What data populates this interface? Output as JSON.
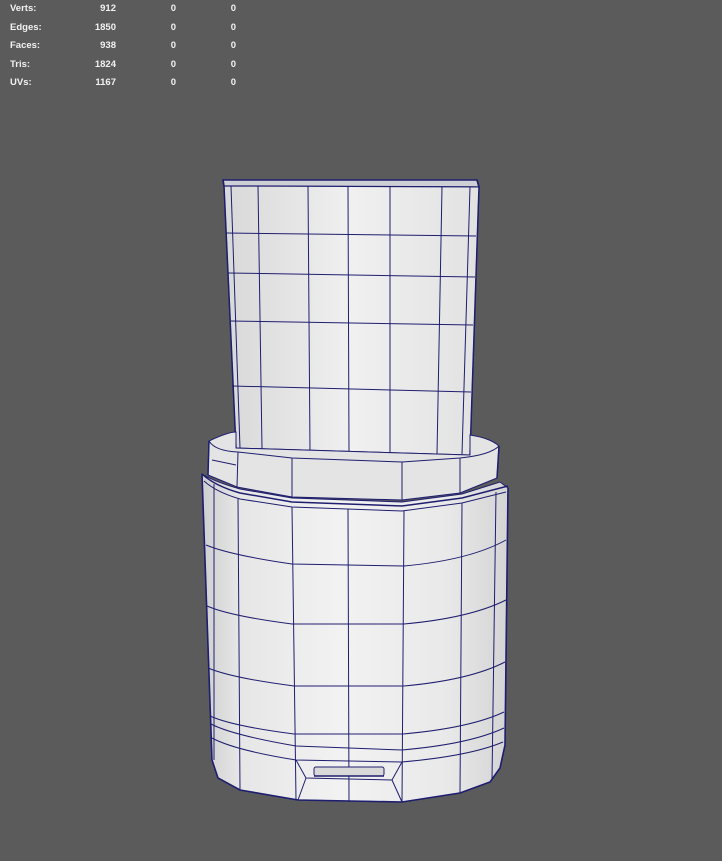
{
  "viewport": {
    "background_color": "#5b5b5b",
    "wireframe_color": "#1a1a6e",
    "shaded_color": "#e8e8e8"
  },
  "hud": {
    "rows": [
      {
        "label": "Verts:",
        "values": [
          "912",
          "0",
          "0"
        ]
      },
      {
        "label": "Edges:",
        "values": [
          "1850",
          "0",
          "0"
        ]
      },
      {
        "label": "Faces:",
        "values": [
          "938",
          "0",
          "0"
        ]
      },
      {
        "label": "Tris:",
        "values": [
          "1824",
          "0",
          "0"
        ]
      },
      {
        "label": "UVs:",
        "values": [
          "1167",
          "0",
          "0"
        ]
      }
    ]
  },
  "model": {
    "object": "usb-flash-drive-mesh"
  }
}
